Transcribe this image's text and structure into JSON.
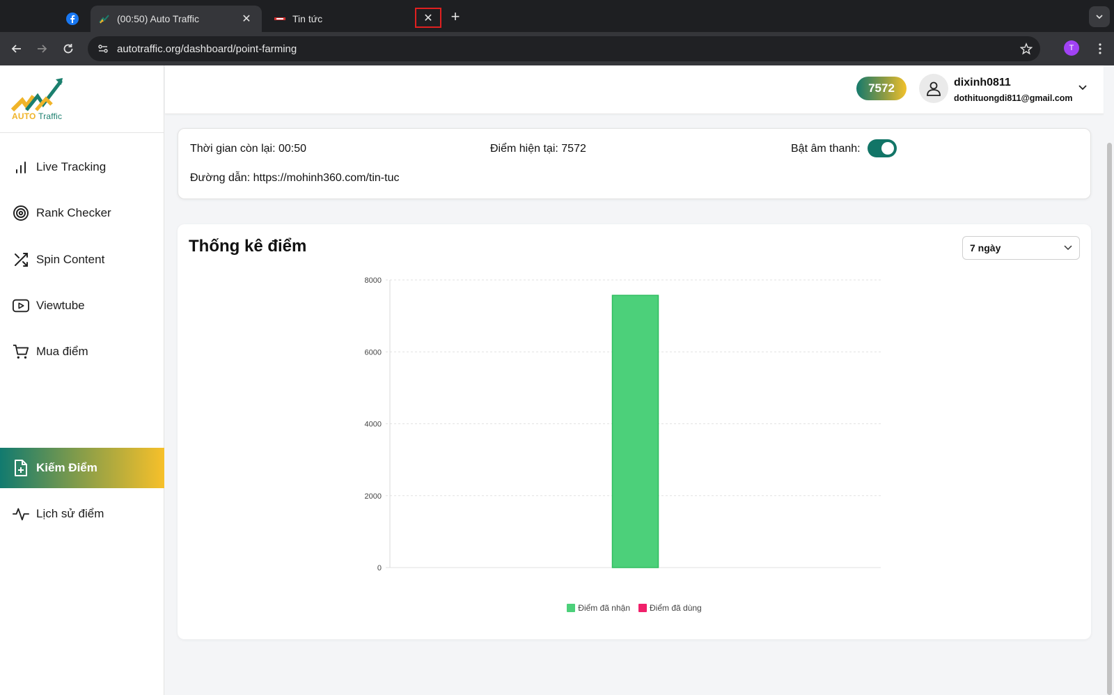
{
  "browser": {
    "tabs": [
      {
        "title": "(00:50) Auto Traffic",
        "active": true
      },
      {
        "title": "Tin tức",
        "active": false
      }
    ],
    "url": "autotraffic.org/dashboard/point-farming",
    "profile_initial": "T"
  },
  "sidebar": {
    "logo_auto": "AUTO",
    "logo_traffic": "Traffic",
    "items": [
      {
        "label": "Live Tracking",
        "icon": "bar-chart-icon"
      },
      {
        "label": "Rank Checker",
        "icon": "target-icon"
      },
      {
        "label": "Spin Content",
        "icon": "shuffle-icon"
      },
      {
        "label": "Viewtube",
        "icon": "youtube-icon"
      },
      {
        "label": "Mua điểm",
        "icon": "cart-icon"
      },
      {
        "label": "Kiếm Điểm",
        "icon": "file-plus-icon",
        "active": true
      },
      {
        "label": "Lịch sử điểm",
        "icon": "activity-icon"
      }
    ]
  },
  "header": {
    "points": "7572",
    "username": "dixinh0811",
    "email": "dothituongdi811@gmail.com"
  },
  "info": {
    "time_left": "Thời gian còn lại: 00:50",
    "current_points": "Điểm hiện tại: 7572",
    "sound_label": "Bật âm thanh:",
    "sound_on": true,
    "path": "Đường dẫn: https://mohinh360.com/tin-tuc"
  },
  "stats": {
    "title": "Thống kê điểm",
    "range_value": "7 ngày"
  },
  "chart_data": {
    "type": "bar",
    "categories": [
      ""
    ],
    "series": [
      {
        "name": "Điểm đã nhận",
        "values": [
          7572
        ],
        "color": "#4cd07a",
        "border": "#2ebd5f"
      },
      {
        "name": "Điểm đã dùng",
        "values": [
          0
        ],
        "color": "#f0206a",
        "border": "#d3125a"
      }
    ],
    "ylim": [
      0,
      8000
    ],
    "yticks": [
      "0",
      "2000",
      "4000",
      "6000",
      "8000"
    ],
    "grid": true,
    "legend_position": "bottom"
  }
}
